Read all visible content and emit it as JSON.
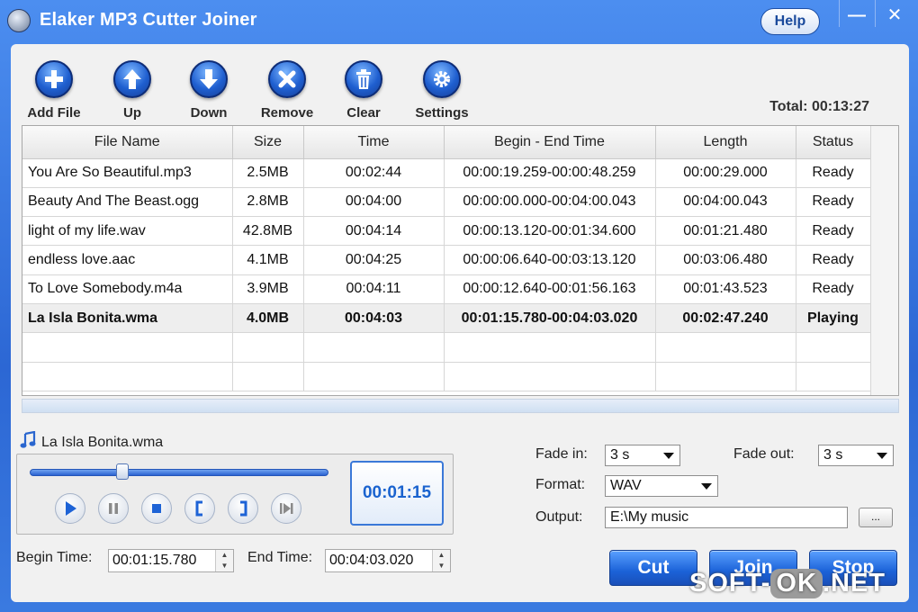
{
  "window": {
    "title": "Elaker MP3 Cutter Joiner",
    "help_label": "Help",
    "minimize": "—",
    "close": "✕"
  },
  "toolbar": {
    "items": [
      {
        "label": "Add File",
        "icon": "plus-icon"
      },
      {
        "label": "Up",
        "icon": "arrow-up-icon"
      },
      {
        "label": "Down",
        "icon": "arrow-down-icon"
      },
      {
        "label": "Remove",
        "icon": "x-icon"
      },
      {
        "label": "Clear",
        "icon": "trash-icon"
      },
      {
        "label": "Settings",
        "icon": "gear-icon"
      }
    ],
    "total": "Total: 00:13:27"
  },
  "table": {
    "columns": [
      "File Name",
      "Size",
      "Time",
      "Begin - End Time",
      "Length",
      "Status"
    ],
    "rows": [
      [
        "You Are So Beautiful.mp3",
        "2.5MB",
        "00:02:44",
        "00:00:19.259-00:00:48.259",
        "00:00:29.000",
        "Ready"
      ],
      [
        "Beauty And The Beast.ogg",
        "2.8MB",
        "00:04:00",
        "00:00:00.000-00:04:00.043",
        "00:04:00.043",
        "Ready"
      ],
      [
        "light of my life.wav",
        "42.8MB",
        "00:04:14",
        "00:00:13.120-00:01:34.600",
        "00:01:21.480",
        "Ready"
      ],
      [
        "endless love.aac",
        "4.1MB",
        "00:04:25",
        "00:00:06.640-00:03:13.120",
        "00:03:06.480",
        "Ready"
      ],
      [
        "To Love Somebody.m4a",
        "3.9MB",
        "00:04:11",
        "00:00:12.640-00:01:56.163",
        "00:01:43.523",
        "Ready"
      ],
      [
        "La Isla Bonita.wma",
        "4.0MB",
        "00:04:03",
        "00:01:15.780-00:04:03.020",
        "00:02:47.240",
        "Playing"
      ]
    ]
  },
  "player": {
    "now_playing": "La Isla Bonita.wma",
    "clock": "00:01:15",
    "seek_fraction": 0.31,
    "begin_label": "Begin Time:",
    "begin_value": "00:01:15.780",
    "end_label": "End Time:",
    "end_value": "00:04:03.020"
  },
  "settings": {
    "fade_in_label": "Fade in:",
    "fade_in_value": "3 s",
    "fade_out_label": "Fade out:",
    "fade_out_value": "3 s",
    "format_label": "Format:",
    "format_value": "WAV",
    "output_label": "Output:",
    "output_value": "E:\\My music",
    "browse_label": "..."
  },
  "actions": {
    "cut": "Cut",
    "join": "Join",
    "stop": "Stop"
  },
  "watermark": {
    "left": "SOFT-",
    "mid": "OK",
    "right": ".NET"
  },
  "colors": {
    "accent": "#2c67d4",
    "playing_row": "#eeeeee"
  }
}
